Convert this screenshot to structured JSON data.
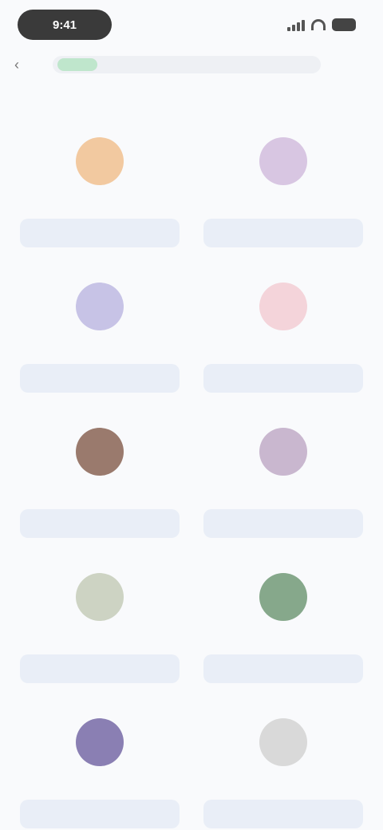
{
  "status_bar": {
    "time": "9:41"
  },
  "nav": {
    "url": ""
  },
  "page": {
    "title": ""
  },
  "grid": {
    "items": [
      {
        "name": "",
        "action": "",
        "avatar_color": "#f2c9a0"
      },
      {
        "name": "",
        "action": "",
        "avatar_color": "#d8c6e2"
      },
      {
        "name": "",
        "action": "",
        "avatar_color": "#c7c3e6"
      },
      {
        "name": "",
        "action": "",
        "avatar_color": "#f4d4da"
      },
      {
        "name": "",
        "action": "",
        "avatar_color": "#9a7a6d"
      },
      {
        "name": "",
        "action": "",
        "avatar_color": "#c9b7cf"
      },
      {
        "name": "",
        "action": "",
        "avatar_color": "#cdd3c3"
      },
      {
        "name": "",
        "action": "",
        "avatar_color": "#86a88b"
      },
      {
        "name": "",
        "action": "",
        "avatar_color": "#8a7fb3"
      },
      {
        "name": "",
        "action": "",
        "avatar_color": "#d9d9d9"
      }
    ]
  },
  "colors": {
    "background": "#f9fafc",
    "action_button": "#e9eef7",
    "status_pill": "#3a3a3a",
    "lock_chip": "#bfe6cc"
  },
  "icons": {
    "back": "chevron-left-icon",
    "lock": "lock-icon",
    "signal": "signal-icon",
    "wifi": "wifi-icon",
    "battery": "battery-icon"
  }
}
